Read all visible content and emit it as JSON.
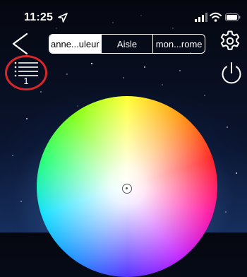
{
  "status_bar": {
    "time": "11:25",
    "location_icon": "location-arrow-icon",
    "signal_icon": "cellular-signal-icon",
    "wifi_icon": "wifi-icon",
    "battery_icon": "battery-icon"
  },
  "nav": {
    "back_icon": "chevron-left-icon",
    "settings_icon": "gear-icon",
    "power_icon": "power-icon"
  },
  "mode_tabs": [
    {
      "label": "anne...uleur",
      "active": true
    },
    {
      "label": "Aisle",
      "active": false
    },
    {
      "label": "mon...rome",
      "active": false
    }
  ],
  "group_list": {
    "icon": "list-icon",
    "count": "1",
    "highlight_color": "#d8262a"
  },
  "color_wheel": {
    "icon": "color-wheel",
    "handle": "center"
  }
}
